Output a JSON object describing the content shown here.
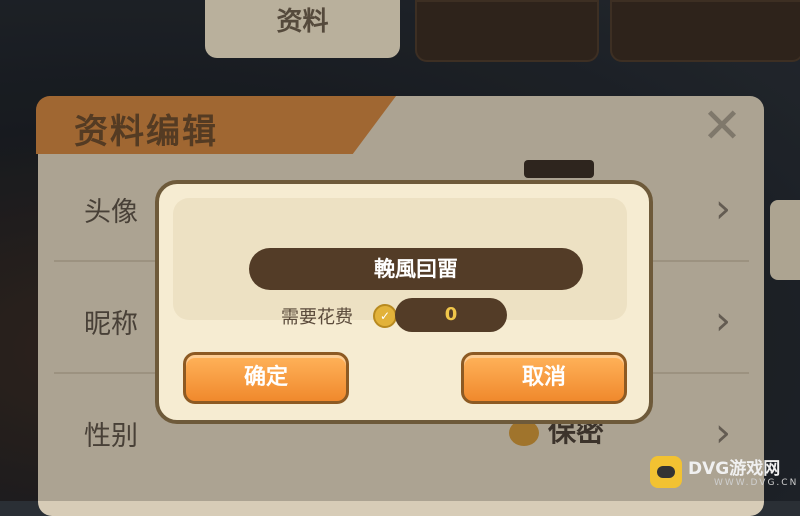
{
  "top_tabs": [
    {
      "label": "资料"
    },
    {
      "label": ""
    },
    {
      "label": ""
    }
  ],
  "panel": {
    "title": "资料编辑",
    "close_icon": "close-icon",
    "rows": [
      {
        "label": "头像",
        "value": ""
      },
      {
        "label": "昵称",
        "value": ""
      },
      {
        "label": "性别",
        "value": "保密"
      }
    ]
  },
  "dialog": {
    "name_value": "輓風囙畱",
    "cost_label": "需要花费",
    "cost_icon": "coin-icon",
    "cost_value": "0",
    "confirm_label": "确定",
    "cancel_label": "取消"
  },
  "watermark": {
    "text": "DVG游戏网",
    "sub": "WWW.DVG.CN"
  },
  "colors": {
    "button": "#f0892d",
    "field": "#533c27",
    "title_banner": "#c9813f",
    "dialog_bg": "#f6ecd2"
  }
}
